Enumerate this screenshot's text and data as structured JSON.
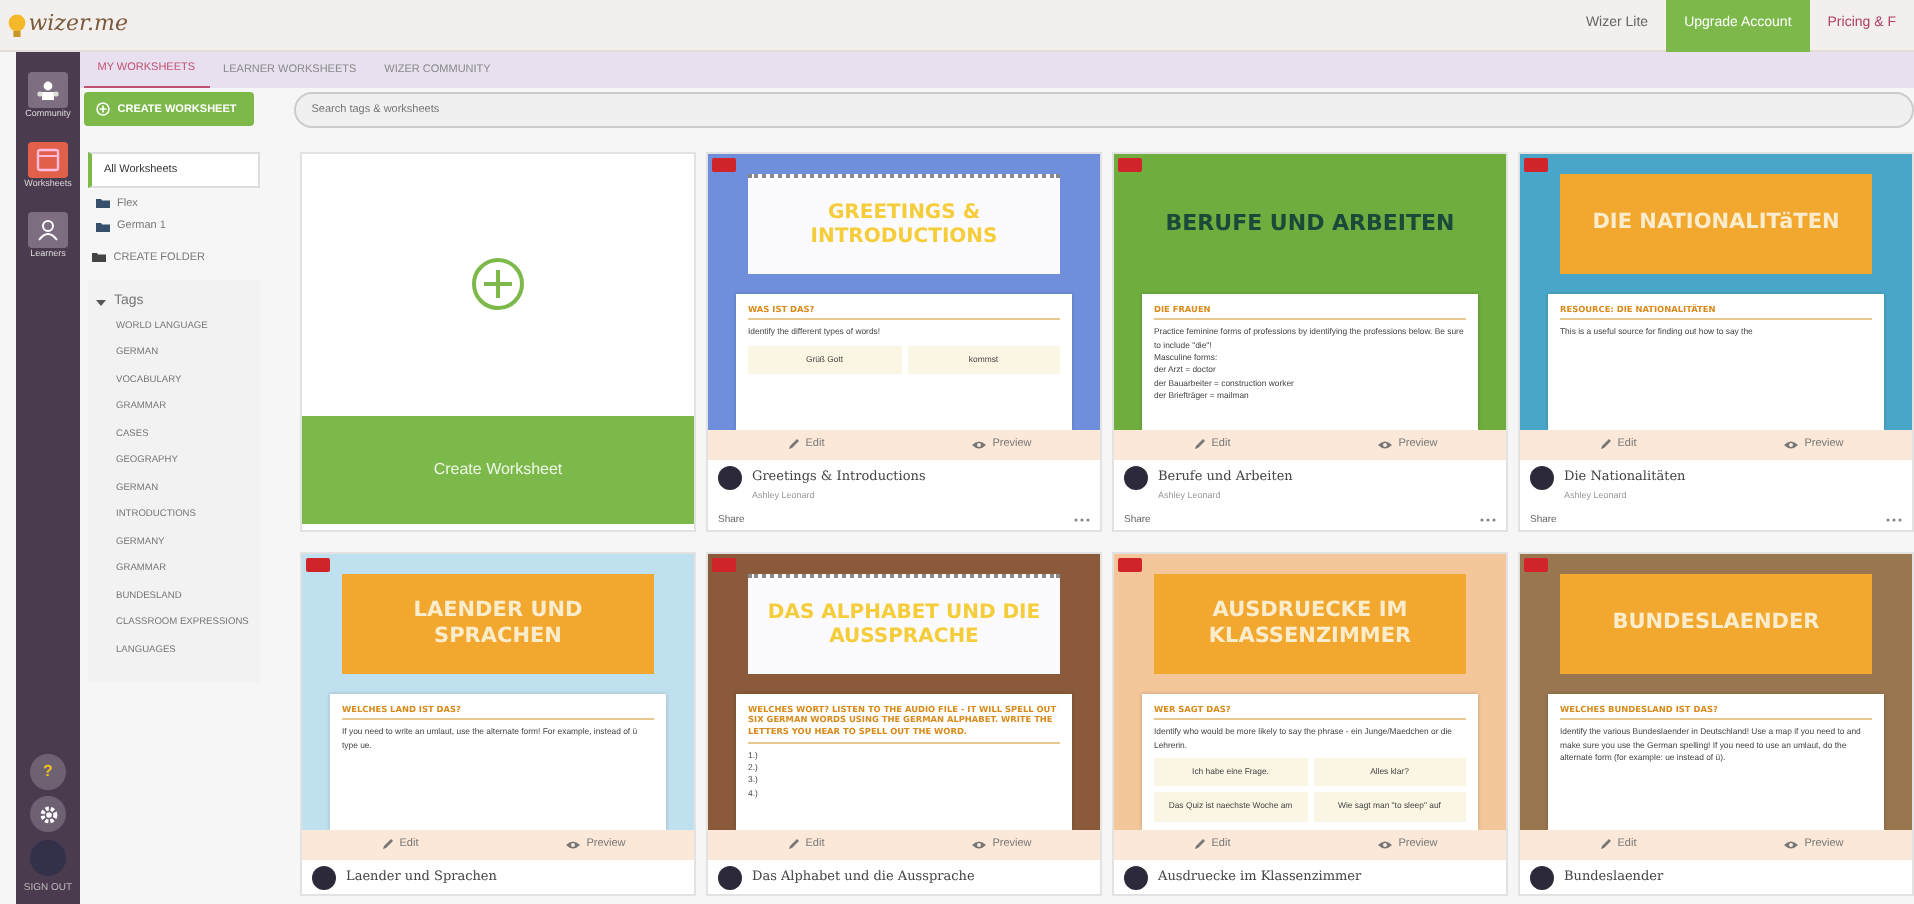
{
  "top_bar": {
    "logo": "wizer.me",
    "links": [
      {
        "label": "Wizer Lite",
        "kind": "plain"
      },
      {
        "label": "Upgrade Account",
        "kind": "primary"
      },
      {
        "label": "Pricing & F",
        "kind": "accent"
      }
    ]
  },
  "side_nav": {
    "items": [
      {
        "label": "Community",
        "selected": false
      },
      {
        "label": "Worksheets",
        "selected": true
      },
      {
        "label": "Learners",
        "selected": false
      }
    ],
    "help": "?",
    "sign_out": "SIGN OUT"
  },
  "tabs": [
    {
      "label": "MY WORKSHEETS",
      "selected": true
    },
    {
      "label": "LEARNER WORKSHEETS",
      "selected": false
    },
    {
      "label": "WIZER COMMUNITY",
      "selected": false
    }
  ],
  "create_button": "CREATE WORKSHEET",
  "search": {
    "placeholder": "Search tags & worksheets"
  },
  "folders": {
    "all": {
      "label": "All Worksheets",
      "selected": true
    },
    "items": [
      "Flex",
      "German 1"
    ],
    "create": "CREATE FOLDER"
  },
  "tags": {
    "heading": "Tags",
    "expanded": true,
    "items": [
      "WORLD LANGUAGE",
      "GERMAN",
      "VOCABULARY",
      "GRAMMAR",
      "CASES",
      "GEOGRAPHY",
      "GERMAN",
      "INTRODUCTIONS",
      "GERMANY",
      "GRAMMAR",
      "BUNDESLAND",
      "CLASSROOM EXPRESSIONS",
      "LANGUAGES"
    ]
  },
  "new_card": {
    "label": "Create Worksheet"
  },
  "worksheets": [
    {
      "title": "Greetings & Introductions",
      "author": "Ashley Leonard",
      "share": "Share",
      "edit": "Edit",
      "preview": "Preview",
      "thumb": {
        "banner": "GREETINGS & INTRODUCTIONS",
        "kind": "paper",
        "color": "#6f8fdc",
        "heading": "WAS IST DAS?",
        "lines": [
          "Identify the different types of words!"
        ],
        "chips": [
          "Grüß Gott",
          "kommst"
        ]
      }
    },
    {
      "title": "Berufe und Arbeiten",
      "author": "Ashley Leonard",
      "share": "Share",
      "edit": "Edit",
      "preview": "Preview",
      "thumb": {
        "banner": "BERUFE UND ARBEITEN",
        "kind": "plain",
        "color": "#6fae3e",
        "heading": "DIE FRAUEN",
        "lines": [
          "Practice feminine forms of professions by identifying the professions below. Be sure to include \"die\"!",
          "Masculine forms:",
          "der Arzt = doctor",
          "der Bauarbeiter = construction worker",
          "der Briefträger = mailman"
        ]
      }
    },
    {
      "title": "Die Nationalitäten",
      "author": "Ashley Leonard",
      "share": "Share",
      "edit": "Edit",
      "preview": "Preview",
      "thumb": {
        "banner": "DIE NATIONALITäTEN",
        "kind": "box",
        "color": "#4aa6c8",
        "heading": "RESOURCE: DIE NATIONALITÄTEN",
        "lines": [
          "This is a useful source for finding out how to say the"
        ]
      }
    },
    {
      "title": "Laender und Sprachen",
      "edit": "Edit",
      "preview": "Preview",
      "thumb": {
        "banner": "LAENDER UND SPRACHEN",
        "kind": "box",
        "color": "#bfe0ef",
        "heading": "WELCHES LAND IST DAS?",
        "lines": [
          "If you need to write an umlaut, use the alternate form! For example, instead of ü type ue."
        ]
      }
    },
    {
      "title": "Das Alphabet und die Aussprache",
      "edit": "Edit",
      "preview": "Preview",
      "thumb": {
        "banner": "DAS ALPHABET UND DIE AUSSPRACHE",
        "kind": "paper",
        "color": "#8a5a3a",
        "heading": "WELCHES WORT? LISTEN TO THE AUDIO FILE - IT WILL SPELL OUT SIX GERMAN WORDS USING THE GERMAN ALPHABET. WRITE THE LETTERS YOU HEAR TO SPELL OUT THE WORD.",
        "lines": [
          "1.)",
          "2.)",
          "3.)",
          "4.)"
        ]
      }
    },
    {
      "title": "Ausdruecke im Klassenzimmer",
      "edit": "Edit",
      "preview": "Preview",
      "thumb": {
        "banner": "AUSDRUECKE IM KLASSENZIMMER",
        "kind": "box",
        "color": "#f3c79a",
        "heading": "WER SAGT DAS?",
        "lines": [
          "Identify who would be more likely to say the phrase - ein Junge/Maedchen or die Lehrerin."
        ],
        "chips": [
          "Ich habe eine Frage.",
          "Alles klar?",
          "Das Quiz ist naechste Woche am",
          "Wie sagt man \"to sleep\" auf"
        ]
      }
    },
    {
      "title": "Bundeslaender",
      "edit": "Edit",
      "preview": "Preview",
      "thumb": {
        "banner": "BUNDESLAENDER",
        "kind": "box",
        "color": "#9a7650",
        "heading": "WELCHES BUNDESLAND IST DAS?",
        "lines": [
          "Identify the various Bundeslaender in Deutschland! Use a map if you need to and make sure you use the German spelling! If you need to use an umlaut, do the alternate form (for example: ue instead of ü)."
        ]
      }
    }
  ]
}
